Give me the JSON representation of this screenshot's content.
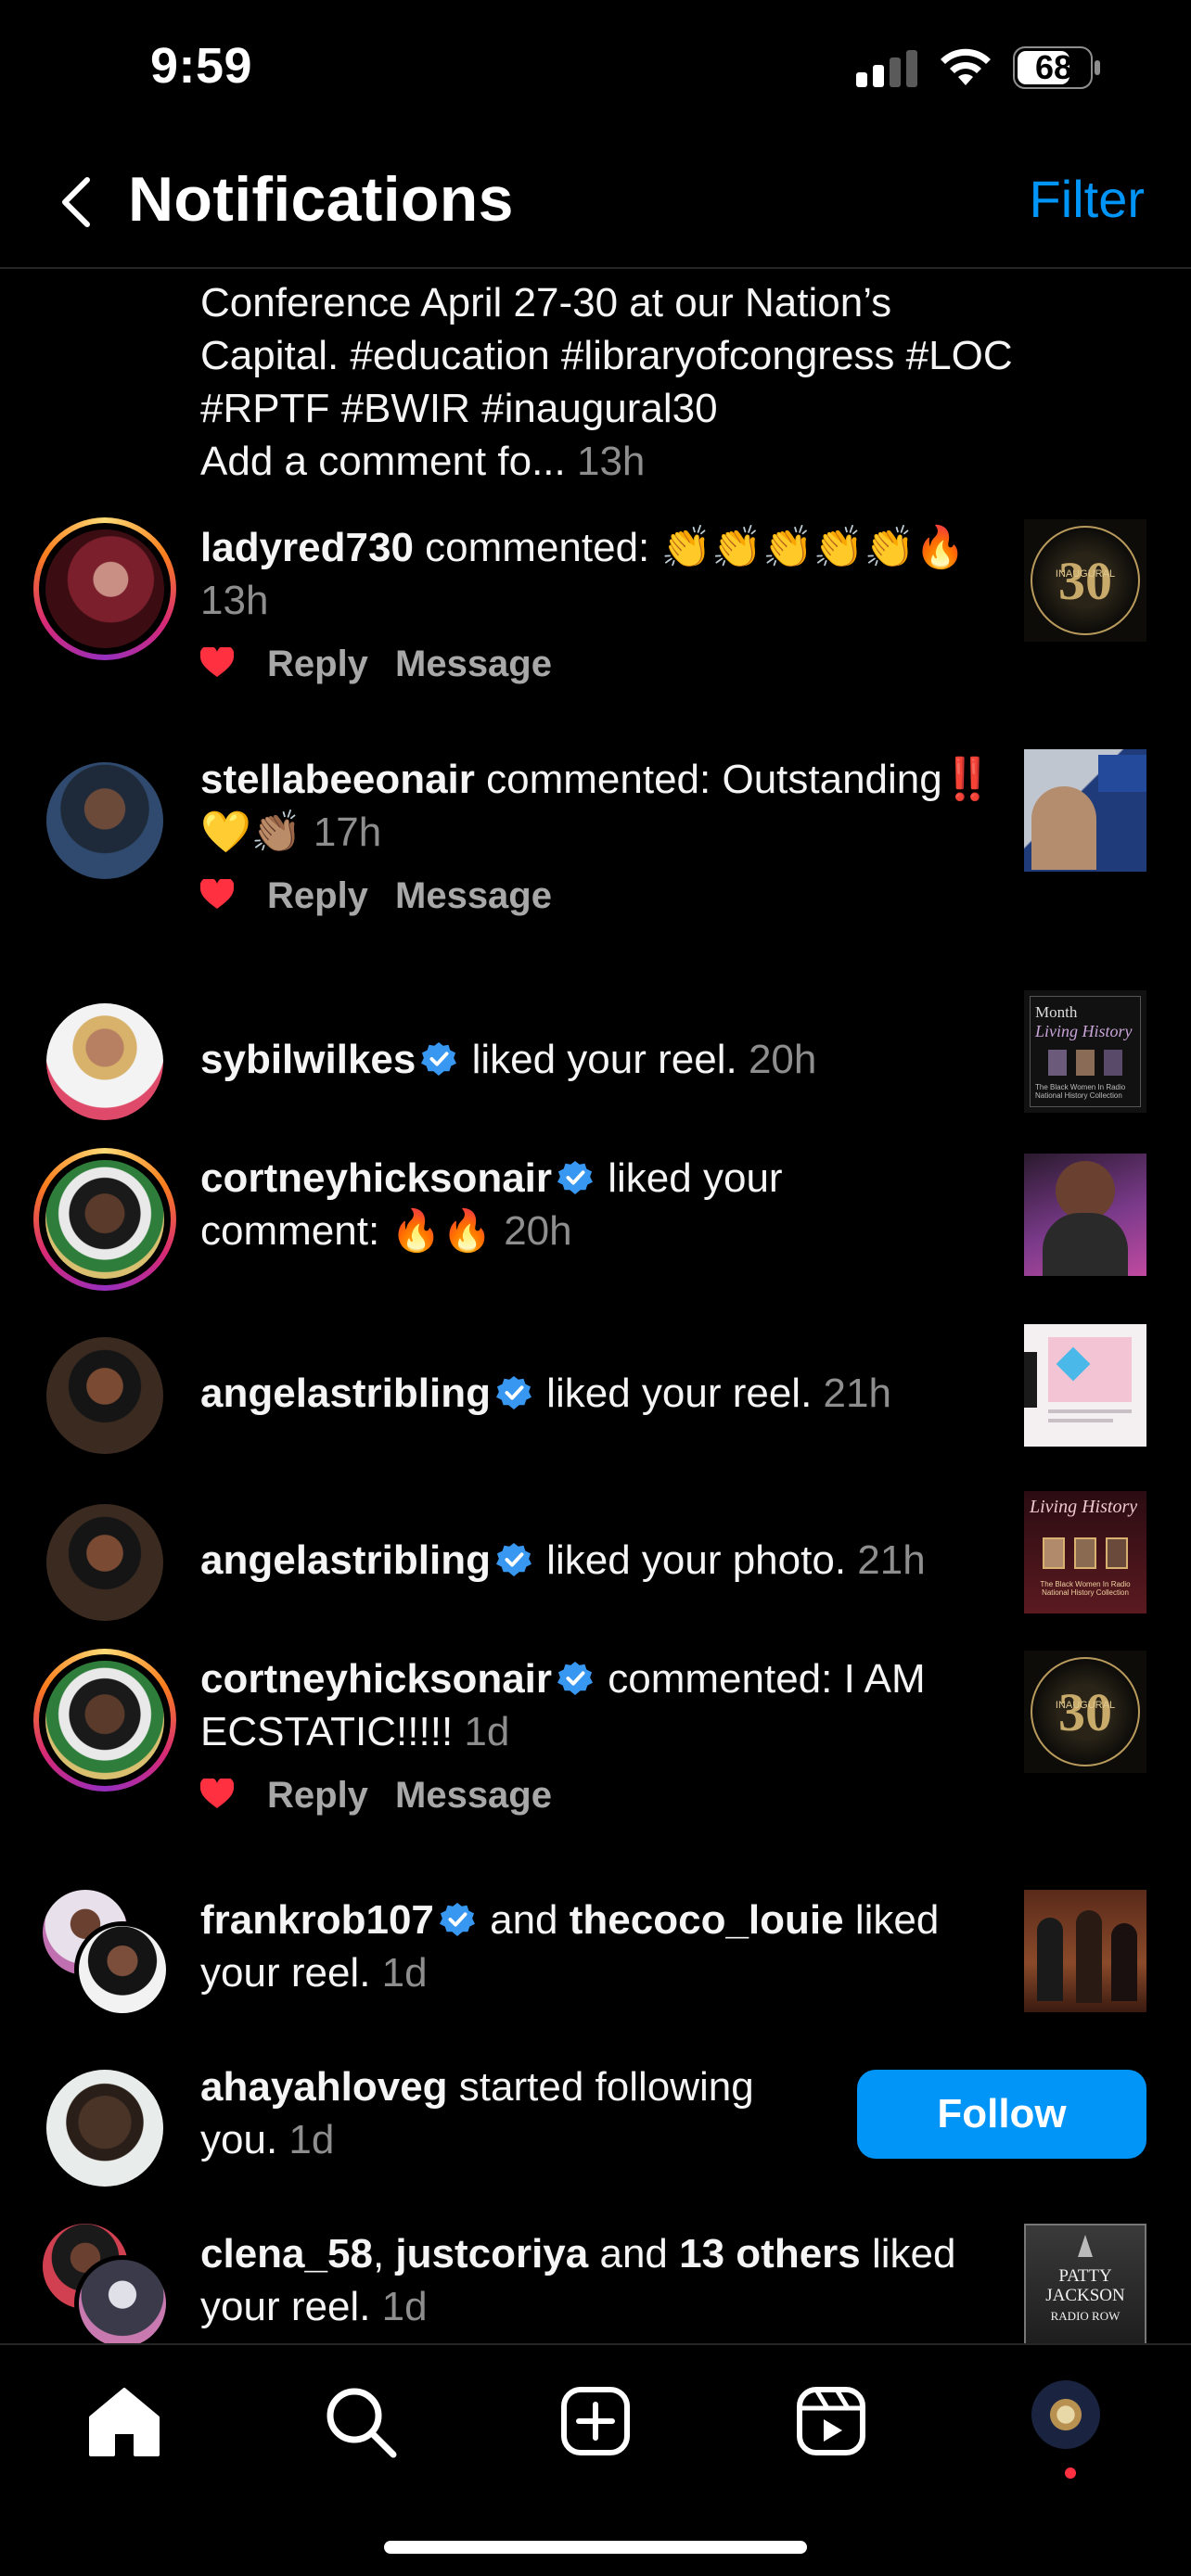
{
  "status_bar": {
    "time": "9:59",
    "battery": "68"
  },
  "header": {
    "title": "Notifications",
    "filter_label": "Filter"
  },
  "partial_caption": {
    "text": "Conference April 27-30 at our Nation’s Capital. #education #libraryofcongress #LOC #RPTF #BWIR #inaugural30",
    "add_comment": "Add a comment fo...",
    "time": "13h"
  },
  "notifications": [
    {
      "user": "ladyred730",
      "action": " commented: ",
      "comment": "👏👏👏👏👏🔥",
      "time": "13h",
      "actions": {
        "reply": "Reply",
        "message": "Message"
      }
    },
    {
      "user": "stellabeeonair",
      "action": " commented: ",
      "comment": "Outstanding‼️💛👏🏽",
      "time": "17h",
      "actions": {
        "reply": "Reply",
        "message": "Message"
      }
    },
    {
      "user": "sybilwilkes",
      "verified": true,
      "action": " liked your reel.",
      "time": "20h"
    },
    {
      "user": "cortneyhicksonair",
      "verified": true,
      "action": " liked your comment: ",
      "comment": "🔥🔥",
      "time": "20h"
    },
    {
      "user": "angelastribling",
      "verified": true,
      "action": " liked your reel.",
      "time": "21h"
    },
    {
      "user": "angelastribling",
      "verified": true,
      "action": " liked your photo.",
      "time": "21h"
    },
    {
      "user": "cortneyhicksonair",
      "verified": true,
      "action": " commented: ",
      "comment": "I AM ECSTATIC!!!!!",
      "time": "1d",
      "actions": {
        "reply": "Reply",
        "message": "Message"
      }
    },
    {
      "user": "frankrob107",
      "verified": true,
      "and": " and ",
      "user2": "thecoco_louie",
      "action": " liked your reel.",
      "time": "1d"
    },
    {
      "user": "ahayahloveg",
      "action": " started following you.",
      "time": "1d",
      "button": "Follow"
    },
    {
      "user": "clena_58",
      "sep": ", ",
      "user2": "justcoriya",
      "and": " and ",
      "others": "13 others",
      "action": " liked your reel.",
      "time": "1d"
    }
  ],
  "thumbnail_text": {
    "inaugural": "INAUGURAL",
    "bwir_arc": "Black Women In Radio",
    "bwir_arc2": "National Historical Collection",
    "living_history": "Living History",
    "month": "Month",
    "radio_national": "The Black Women In Radio National History Collection",
    "patty1": "PATTY",
    "patty2": "JACKSON",
    "patty3": "RADIO ROW"
  },
  "tabbar": {
    "items": [
      "home",
      "search",
      "create",
      "reels",
      "profile"
    ]
  },
  "colors": {
    "accent": "#0095f6",
    "like_red": "#ff3040",
    "secondary_text": "#8e8e8e"
  }
}
